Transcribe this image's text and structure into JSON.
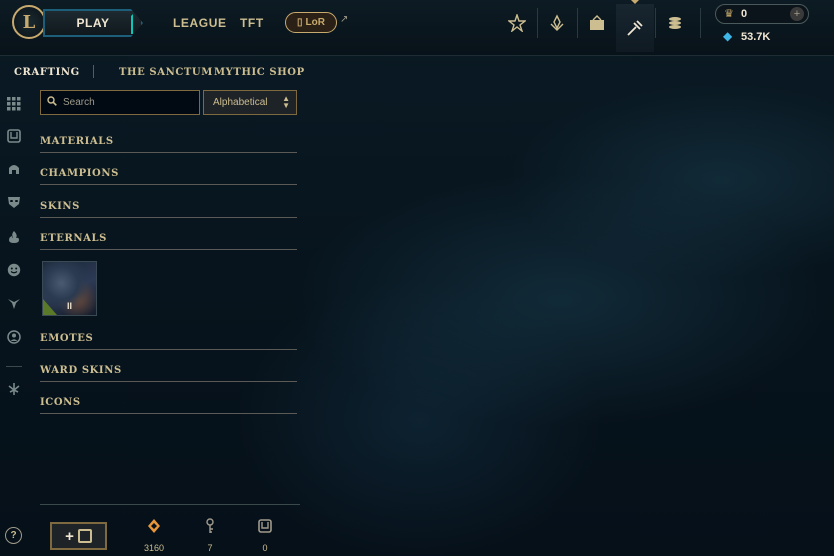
{
  "topbar": {
    "logo_letter": "L",
    "play_label": "PLAY",
    "nav": [
      "LEAGUE",
      "TFT"
    ],
    "lor_label": "LoR",
    "icons": [
      "crest-icon",
      "mastery-icon",
      "store-icon",
      "crafting-icon",
      "collection-coins-icon"
    ],
    "active_icon": "crafting-icon"
  },
  "currency": {
    "rp": "0",
    "blue_essence": "53.7K"
  },
  "subnav": {
    "items": [
      "CRAFTING",
      "THE SANCTUM",
      "MYTHIC SHOP"
    ],
    "active": "CRAFTING"
  },
  "rail_icons": [
    "grid-icon",
    "chest-icon",
    "helmet-icon",
    "mask-icon",
    "flame-icon",
    "emote-icon",
    "ward-icon",
    "profile-icon",
    "rune-icon"
  ],
  "search": {
    "placeholder": "Search",
    "sort_value": "Alphabetical"
  },
  "categories": {
    "materials": "MATERIALS",
    "champions": "CHAMPIONS",
    "skins": "SKINS",
    "eternals": "ETERNALS",
    "emotes": "EMOTES",
    "ward_skins": "WARD SKINS",
    "icons": "ICONS"
  },
  "eternals_items": [
    {
      "tier": "II"
    }
  ],
  "footer": {
    "help": "?",
    "add_label": "+",
    "inventory": [
      {
        "icon": "orange-essence-icon",
        "value": "3160",
        "color": "#e8963a"
      },
      {
        "icon": "key-icon",
        "value": "7",
        "color": "#a09b8c"
      },
      {
        "icon": "chest-icon",
        "value": "0",
        "color": "#a09b8c"
      }
    ]
  }
}
